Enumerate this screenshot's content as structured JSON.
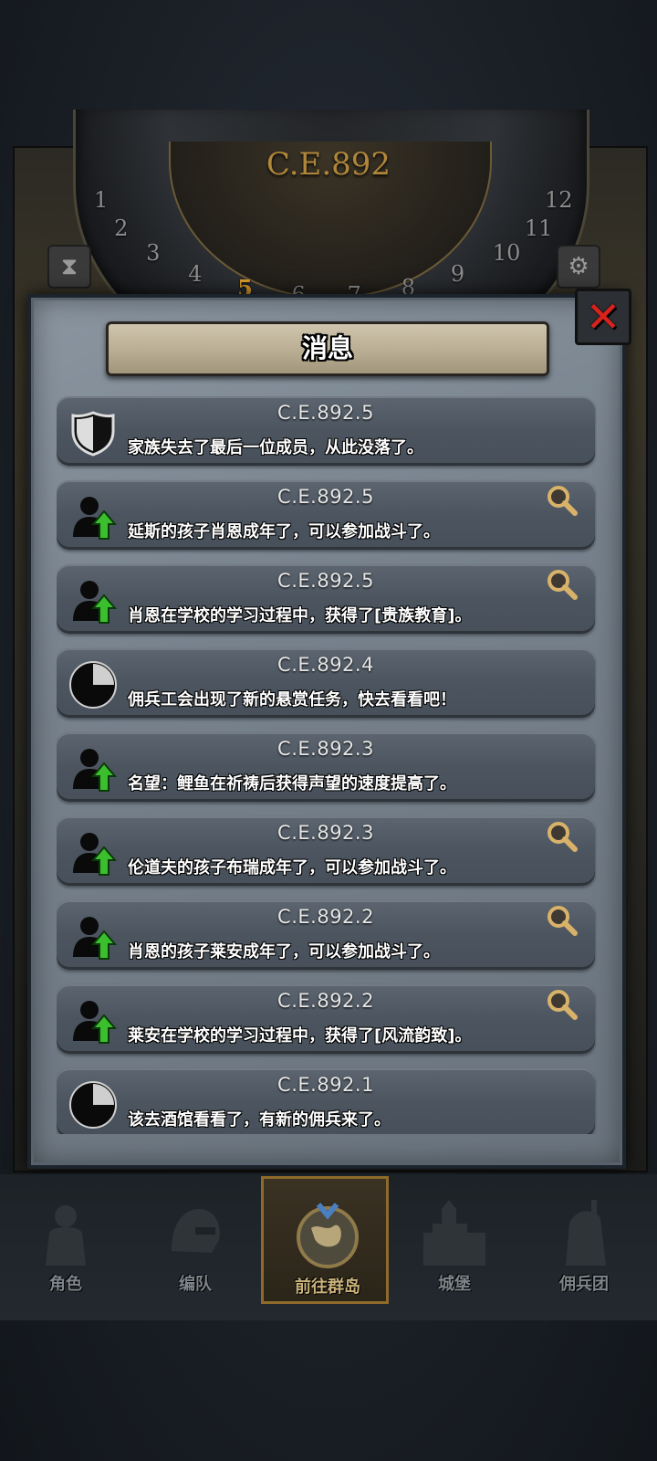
{
  "scene": {
    "era": "C.E.892",
    "hours": [
      "1",
      "2",
      "3",
      "4",
      "5",
      "6",
      "7",
      "8",
      "9",
      "10",
      "11",
      "12"
    ],
    "active_hour": "5"
  },
  "panel": {
    "title": "消息",
    "close_label": "✕"
  },
  "messages": [
    {
      "date": "C.E.892.5",
      "text": "家族失去了最后一位成员，从此没落了。",
      "icon": "shield-icon",
      "search": false
    },
    {
      "date": "C.E.892.5",
      "text": "延斯的孩子肖恩成年了，可以参加战斗了。",
      "icon": "person-up-arrow-icon",
      "search": true
    },
    {
      "date": "C.E.892.5",
      "text": "肖恩在学校的学习过程中，获得了[贵族教育]。",
      "icon": "person-up-arrow-icon",
      "search": true
    },
    {
      "date": "C.E.892.4",
      "text": "佣兵工会出现了新的悬赏任务，快去看看吧！",
      "icon": "pie-clock-icon",
      "search": false
    },
    {
      "date": "C.E.892.3",
      "text": "名望：鲤鱼在祈祷后获得声望的速度提高了。",
      "icon": "person-up-arrow-icon",
      "search": false
    },
    {
      "date": "C.E.892.3",
      "text": "伦道夫的孩子布瑞成年了，可以参加战斗了。",
      "icon": "person-up-arrow-icon",
      "search": true
    },
    {
      "date": "C.E.892.2",
      "text": "肖恩的孩子莱安成年了，可以参加战斗了。",
      "icon": "person-up-arrow-icon",
      "search": true
    },
    {
      "date": "C.E.892.2",
      "text": "莱安在学校的学习过程中，获得了[风流韵致]。",
      "icon": "person-up-arrow-icon",
      "search": true
    },
    {
      "date": "C.E.892.1",
      "text": "该去酒馆看看了，有新的佣兵来了。",
      "icon": "pie-clock-icon",
      "search": false
    }
  ],
  "nav": [
    {
      "label": "角色",
      "icon": "knight-icon",
      "active": false
    },
    {
      "label": "编队",
      "icon": "helmet-icon",
      "active": false
    },
    {
      "label": "前往群岛",
      "icon": "globe-icon",
      "active": true
    },
    {
      "label": "城堡",
      "icon": "castle-icon",
      "active": false
    },
    {
      "label": "佣兵团",
      "icon": "mercenary-icon",
      "active": false
    }
  ],
  "colors": {
    "accent_gold": "#b0863a",
    "close_red": "#d8231d",
    "up_arrow_green": "#3bbf2f",
    "search_gold": "#d9b26a"
  }
}
